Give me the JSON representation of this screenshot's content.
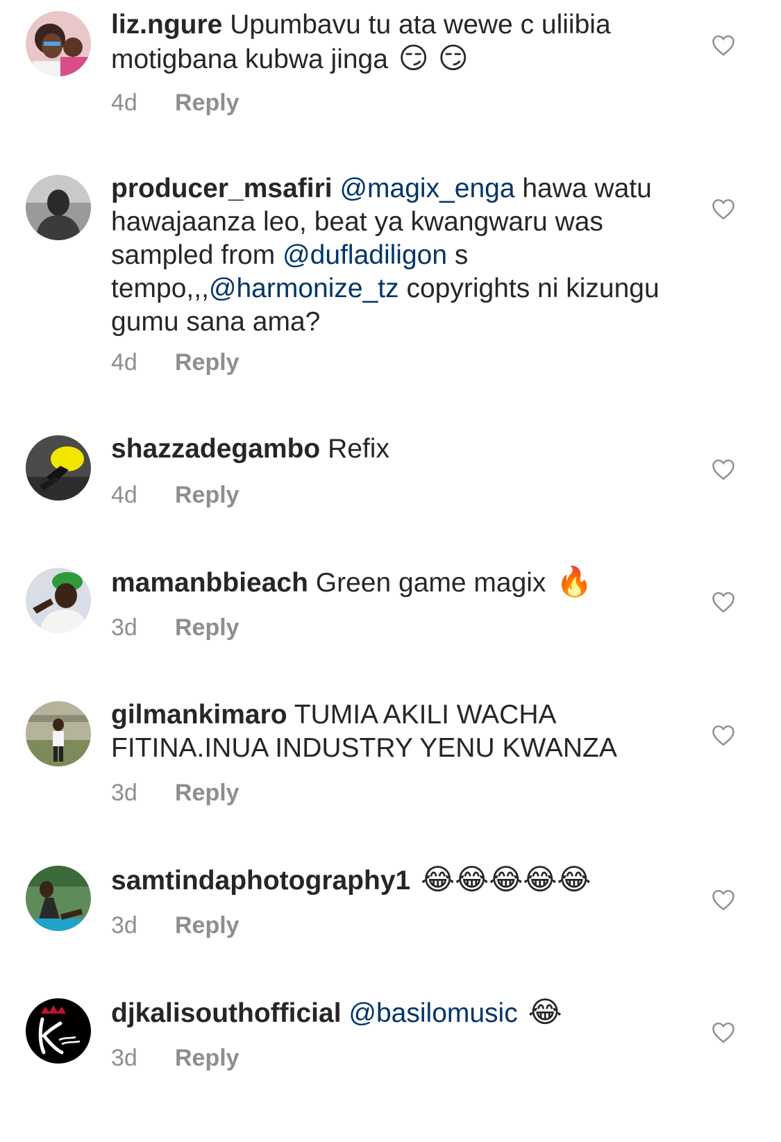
{
  "colors": {
    "text": "#262626",
    "secondary": "#8e8e8e",
    "mention": "#003569",
    "background": "#ffffff"
  },
  "reply_label": "Reply",
  "like_icon": "heart-outline-icon",
  "comments": [
    {
      "username": "liz.ngure",
      "parts": [
        {
          "t": "Upumbavu tu ata wewe c uliibia motigbana kubwa jinga "
        }
      ],
      "emoji": "😏 😏",
      "time": "4d"
    },
    {
      "username": "producer_msafiri",
      "parts": [
        {
          "t": "@magix_enga",
          "mention": true
        },
        {
          "t": " hawa watu hawajaanza leo, beat ya kwangwaru was sampled from "
        },
        {
          "t": "@dufladiligon",
          "mention": true
        },
        {
          "t": " s tempo,,,"
        },
        {
          "t": "@harmonize_tz",
          "mention": true
        },
        {
          "t": " copyrights ni kizungu gumu sana ama?"
        }
      ],
      "emoji": "",
      "time": "4d"
    },
    {
      "username": "shazzadegambo",
      "parts": [
        {
          "t": "Refix"
        }
      ],
      "emoji": "",
      "time": "4d"
    },
    {
      "username": "mamanbbieach",
      "parts": [
        {
          "t": "Green game magix "
        }
      ],
      "emoji": "🔥",
      "time": "3d"
    },
    {
      "username": "gilmankimaro",
      "parts": [
        {
          "t": "TUMIA AKILI WACHA FITINA.INUA INDUSTRY YENU KWANZA"
        }
      ],
      "emoji": "",
      "time": "3d"
    },
    {
      "username": "samtindaphotography1",
      "parts": [
        {
          "t": " "
        }
      ],
      "emoji": "😂😂😂😂😂",
      "time": "3d"
    },
    {
      "username": "djkalisouthofficial",
      "parts": [
        {
          "t": "@basilomusic",
          "mention": true
        },
        {
          "t": " "
        }
      ],
      "emoji": "😂",
      "time": "3d"
    }
  ]
}
